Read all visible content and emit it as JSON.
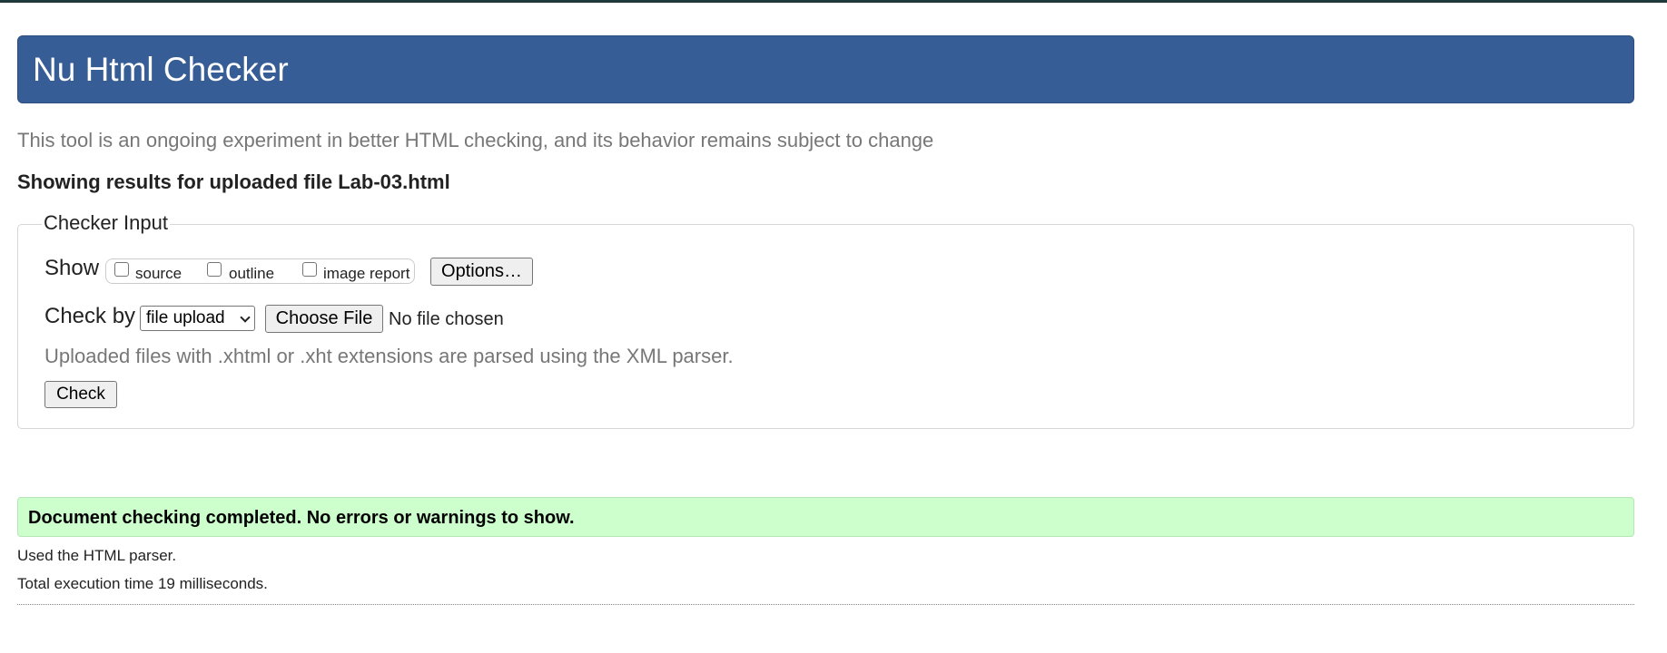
{
  "header": {
    "title": "Nu Html Checker"
  },
  "intro": "This tool is an ongoing experiment in better HTML checking, and its behavior remains subject to change",
  "results_heading": "Showing results for uploaded file Lab-03.html",
  "checker_input": {
    "legend": "Checker Input",
    "show_label": "Show",
    "show_options": [
      {
        "label": "source",
        "checked": false
      },
      {
        "label": "outline",
        "checked": false
      },
      {
        "label": "image report",
        "checked": false
      }
    ],
    "options_button": "Options…",
    "check_by_label": "Check by",
    "check_by_selected": "file upload",
    "choose_file_button": "Choose File",
    "no_file_text": "No file chosen",
    "hint": "Uploaded files with .xhtml or .xht extensions are parsed using the XML parser.",
    "check_button": "Check"
  },
  "result": {
    "success_message": "Document checking completed. No errors or warnings to show.",
    "parser_note": "Used the HTML parser.",
    "execution_time": "Total execution time 19 milliseconds."
  },
  "colors": {
    "banner_bg": "#365d95",
    "success_bg": "#ccffcc",
    "muted_text": "#777777"
  }
}
